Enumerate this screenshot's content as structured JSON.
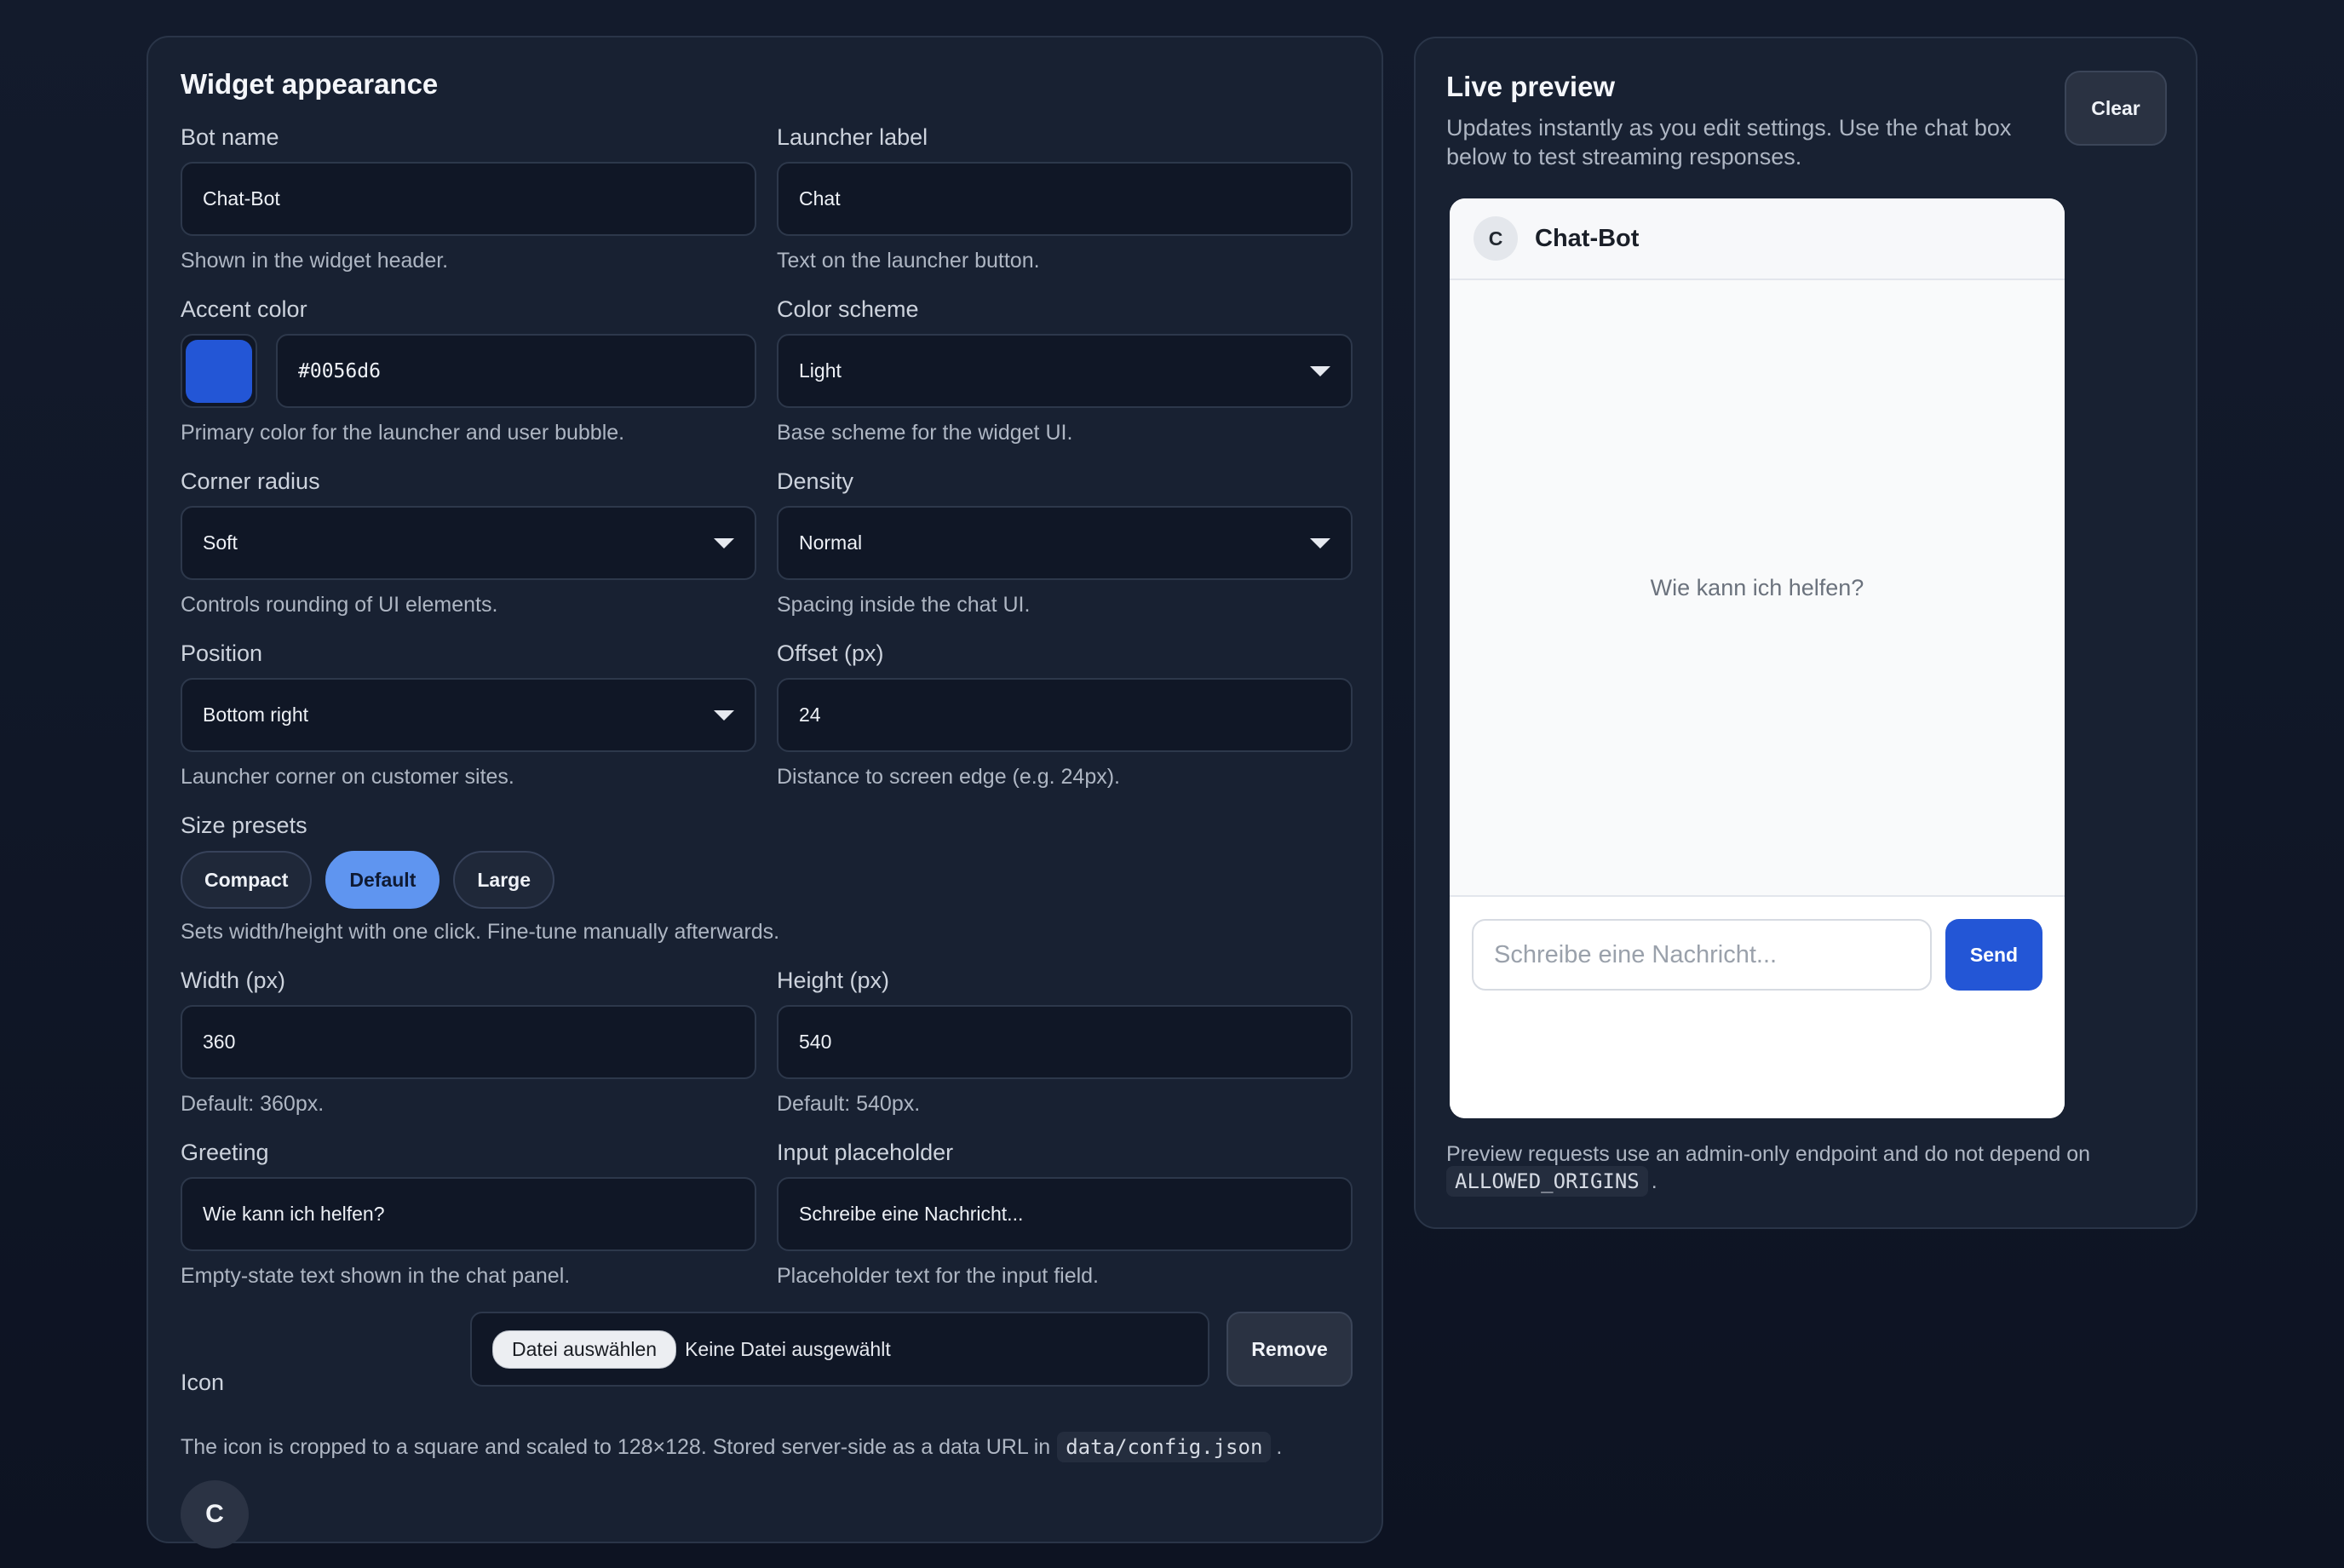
{
  "appearance": {
    "title": "Widget appearance",
    "bot_name": {
      "label": "Bot name",
      "value": "Chat-Bot",
      "help": "Shown in the widget header."
    },
    "launcher_label": {
      "label": "Launcher label",
      "value": "Chat",
      "help": "Text on the launcher button."
    },
    "accent_color": {
      "label": "Accent color",
      "value": "#0056d6",
      "swatch": "#2356d6",
      "help": "Primary color for the launcher and user bubble."
    },
    "color_scheme": {
      "label": "Color scheme",
      "value": "Light",
      "help": "Base scheme for the widget UI."
    },
    "corner_radius": {
      "label": "Corner radius",
      "value": "Soft",
      "help": "Controls rounding of UI elements."
    },
    "density": {
      "label": "Density",
      "value": "Normal",
      "help": "Spacing inside the chat UI."
    },
    "position": {
      "label": "Position",
      "value": "Bottom right",
      "help": "Launcher corner on customer sites."
    },
    "offset": {
      "label": "Offset (px)",
      "value": "24",
      "help": "Distance to screen edge (e.g. 24px)."
    },
    "size_presets": {
      "label": "Size presets",
      "options": [
        "Compact",
        "Default",
        "Large"
      ],
      "selected": "Default",
      "help": "Sets width/height with one click. Fine-tune manually afterwards."
    },
    "width": {
      "label": "Width (px)",
      "value": "360",
      "help": "Default: 360px."
    },
    "height": {
      "label": "Height (px)",
      "value": "540",
      "help": "Default: 540px."
    },
    "greeting": {
      "label": "Greeting",
      "value": "Wie kann ich helfen?",
      "help": "Empty-state text shown in the chat panel."
    },
    "input_placeholder": {
      "label": "Input placeholder",
      "value": "Schreibe eine Nachricht...",
      "help": "Placeholder text for the input field."
    },
    "icon": {
      "label": "Icon",
      "choose_button": "Datei auswählen",
      "file_status": "Keine Datei ausgewählt",
      "remove_button": "Remove",
      "help_prefix": "The icon is cropped to a square and scaled to 128×128. Stored server-side as a data URL in",
      "help_code": "data/config.json",
      "help_suffix": ".",
      "avatar_letter": "C"
    }
  },
  "preview": {
    "title": "Live preview",
    "description": "Updates instantly as you edit settings. Use the chat box below to test streaming responses.",
    "clear_button": "Clear",
    "widget": {
      "avatar_letter": "C",
      "name": "Chat-Bot",
      "greeting": "Wie kann ich helfen?",
      "input_placeholder": "Schreibe eine Nachricht...",
      "send_button": "Send"
    },
    "note_prefix": "Preview requests use an admin-only endpoint and do not depend on",
    "note_code": "ALLOWED_ORIGINS",
    "note_suffix": "."
  },
  "icons": {
    "dropdown": "chevron-down-icon"
  }
}
